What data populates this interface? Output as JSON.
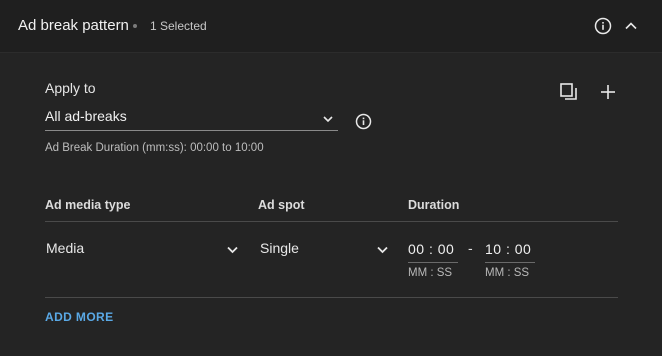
{
  "header": {
    "title": "Ad break pattern",
    "selected_count": "1 Selected"
  },
  "apply_to": {
    "label": "Apply to",
    "value": "All ad-breaks",
    "duration_hint": "Ad Break Duration (mm:ss): 00:00 to 10:00"
  },
  "table": {
    "headers": {
      "media_type": "Ad media type",
      "ad_spot": "Ad spot",
      "duration": "Duration"
    },
    "row": {
      "media_type": "Media",
      "ad_spot": "Single",
      "start_time": "00 : 00",
      "separator": "-",
      "end_time": "10 : 00",
      "time_format": "MM : SS"
    }
  },
  "add_more_label": "ADD MORE",
  "icons": {
    "header_info": "info-icon",
    "collapse": "chevron-up-icon",
    "copy": "copy-icon",
    "add": "plus-icon",
    "apply_info": "info-icon",
    "dropdown": "chevron-down-icon"
  },
  "colors": {
    "background": "#242424",
    "header_background": "#1f1f1f",
    "accent": "#5aa9e6"
  }
}
